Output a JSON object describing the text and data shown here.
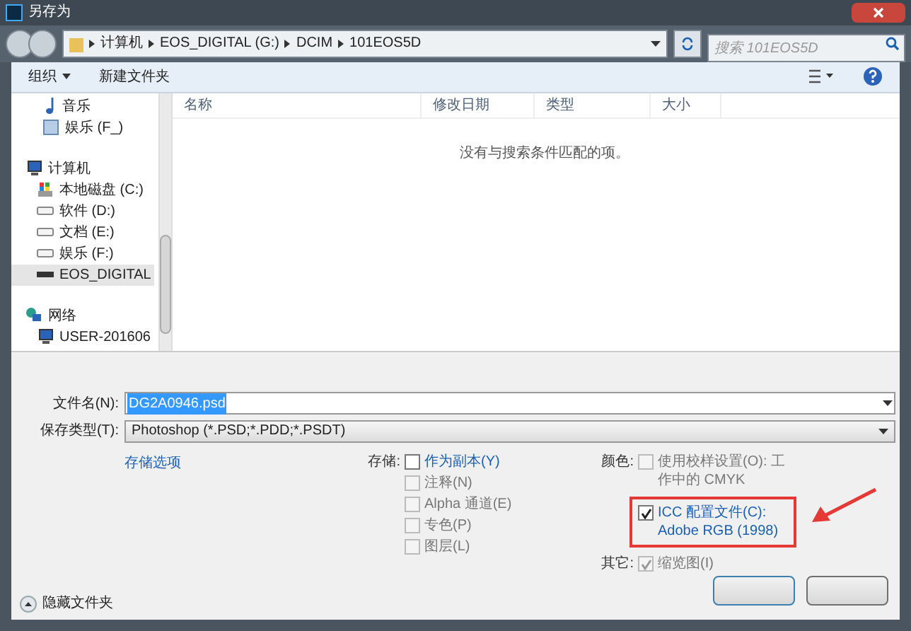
{
  "window": {
    "title": "另存为"
  },
  "address_bar": {
    "path": [
      "计算机",
      "EOS_DIGITAL (G:)",
      "DCIM",
      "101EOS5D"
    ]
  },
  "search": {
    "placeholder": "搜索 101EOS5D"
  },
  "toolbar": {
    "items": [
      "组织",
      "新建文件夹"
    ]
  },
  "sidebar": {
    "items": [
      {
        "label": "音乐",
        "kind": "music",
        "selected": false
      },
      {
        "label": "娱乐 (F_)",
        "kind": "library",
        "selected": false
      },
      {
        "label": "计算机",
        "kind": "computer",
        "selected": false,
        "children": [
          {
            "label": "本地磁盘 (C:)",
            "kind": "system-drive",
            "selected": false
          },
          {
            "label": "软件 (D:)",
            "kind": "drive",
            "selected": false
          },
          {
            "label": "文档 (E:)",
            "kind": "drive",
            "selected": false
          },
          {
            "label": "娱乐 (F:)",
            "kind": "drive",
            "selected": false
          },
          {
            "label": "EOS_DIGITAL",
            "kind": "card",
            "selected": true
          }
        ]
      },
      {
        "label": "网络",
        "kind": "network",
        "selected": false,
        "children": [
          {
            "label": "USER-201606",
            "kind": "computer",
            "selected": false
          }
        ]
      }
    ]
  },
  "file_list": {
    "columns": [
      "名称",
      "修改日期",
      "类型",
      "大小"
    ],
    "empty_message": "没有与搜索条件匹配的项。"
  },
  "form": {
    "file_name": {
      "label": "文件名(N):",
      "value": "DG2A0946.psd"
    },
    "save_type": {
      "label": "保存类型(T):",
      "value": "Photoshop (*.PSD;*.PDD;*.PSDT)"
    }
  },
  "save_options_link": "存储选项",
  "option_groups": [
    {
      "label": "存储:",
      "options": [
        {
          "label": "作为副本(Y)",
          "checked": false,
          "disabled": false,
          "annotated": false
        },
        {
          "label": "注释(N)",
          "checked": false,
          "disabled": true,
          "annotated": false
        },
        {
          "label": "Alpha 通道(E)",
          "checked": false,
          "disabled": true,
          "annotated": false
        },
        {
          "label": "专色(P)",
          "checked": false,
          "disabled": true,
          "annotated": false
        },
        {
          "label": "图层(L)",
          "checked": false,
          "disabled": true,
          "annotated": false
        }
      ]
    },
    {
      "label": "颜色:",
      "options": [
        {
          "label": "使用校样设置(O): 工作中的 CMYK",
          "checked": false,
          "disabled": true,
          "annotated": false
        },
        {
          "label": "ICC 配置文件(C): Adobe RGB (1998)",
          "checked": true,
          "disabled": false,
          "annotated": true
        }
      ]
    },
    {
      "label": "其它:",
      "options": [
        {
          "label": "缩览图(I)",
          "checked": true,
          "disabled": true,
          "annotated": false
        }
      ]
    }
  ],
  "hide_folders": "隐藏文件夹",
  "buttons": [
    {
      "kind": "primary"
    },
    {
      "kind": "normal"
    }
  ]
}
